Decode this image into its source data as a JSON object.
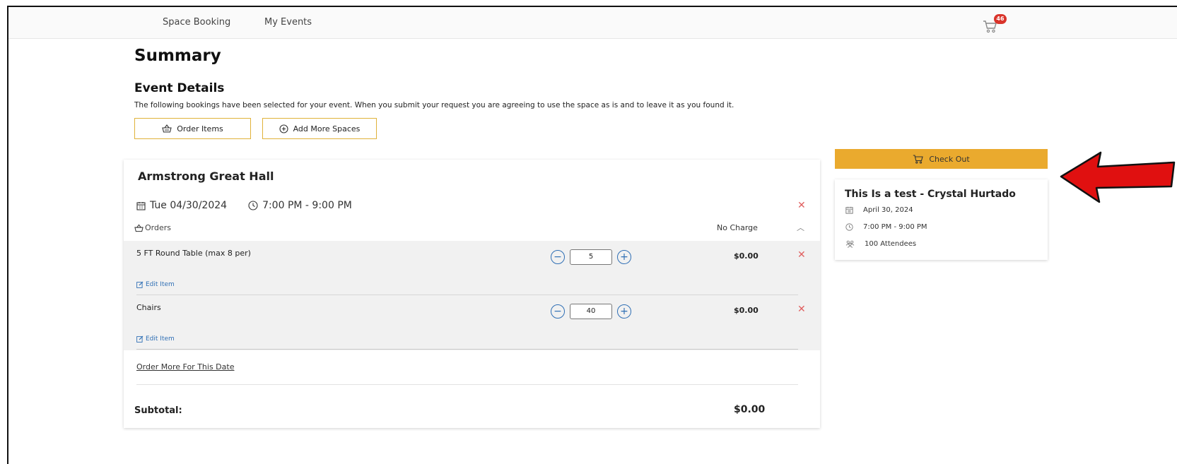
{
  "nav": {
    "items": [
      "Space Booking",
      "My Events"
    ],
    "cart_count": "46"
  },
  "page": {
    "title": "Summary",
    "section_title": "Event Details",
    "description": "The following bookings have been selected for your event. When you submit your request you are agreeing to use the space as is and to leave it as you found it.",
    "order_items_label": "Order Items",
    "add_spaces_label": "Add More Spaces"
  },
  "booking": {
    "venue": "Armstrong Great Hall",
    "date": "Tue 04/30/2024",
    "time": "7:00 PM - 9:00 PM",
    "orders_label": "Orders",
    "orders_charge": "No Charge",
    "items": [
      {
        "name": "5 FT Round Table (max 8 per)",
        "quantity": "5",
        "price": "$0.00",
        "edit_label": "Edit Item"
      },
      {
        "name": "Chairs",
        "quantity": "40",
        "price": "$0.00",
        "edit_label": "Edit Item"
      }
    ],
    "order_more_label": "Order More For This Date",
    "subtotal_label": "Subtotal:",
    "subtotal_value": "$0.00"
  },
  "sidebar": {
    "checkout_label": "Check Out",
    "event_title": "This Is a test - Crystal Hurtado",
    "event_date": "April 30, 2024",
    "event_time": "7:00 PM - 9:00 PM",
    "event_attendees": "100 Attendees"
  },
  "colors": {
    "accent": "#eaaa2e",
    "link": "#2f6fb5",
    "remove": "#e06060",
    "badge": "#d9342b",
    "annotation_arrow": "#e01010"
  }
}
